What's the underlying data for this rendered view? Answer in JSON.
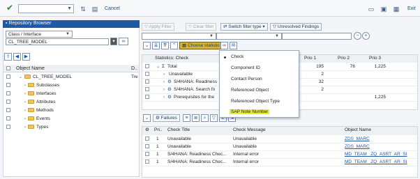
{
  "toolbar": {
    "cancel_label": "Cancel",
    "exit_label": "Exit"
  },
  "left": {
    "header_title": "Repository Browser",
    "object_type_value": "Class / Interface",
    "object_name_value": "CL_TREE_MODEL",
    "col_object_name": "Object Name",
    "col_d": "D..",
    "tree": [
      {
        "label": "CL_TREE_MODEL",
        "extra": "Tre"
      },
      {
        "label": "Subclasses"
      },
      {
        "label": "Interfaces"
      },
      {
        "label": "Attributes"
      },
      {
        "label": "Methods"
      },
      {
        "label": "Events"
      },
      {
        "label": "Types"
      }
    ]
  },
  "filters": {
    "apply": "Apply Filter",
    "clear": "Clear filter",
    "switch": "Switch filter type",
    "unresolved": "Unresolved Findings"
  },
  "stats": {
    "choose_label": "Choose statistic",
    "col_check": "Statistics: Check",
    "col_prio1": "Prio 1",
    "col_prio2": "Prio 2",
    "col_prio3": "Prio 3",
    "rows": [
      {
        "label": "Total",
        "p1": "195",
        "p2": "76",
        "p3": "1,225"
      },
      {
        "label": "Unavailable",
        "p1": "2",
        "p2": "",
        "p3": ""
      },
      {
        "label": "S/4HANA: Readiness",
        "p1": "32",
        "p2": "",
        "p3": ""
      },
      {
        "label": "S/4HANA: Search fo",
        "p1": "2",
        "p2": "",
        "p3": ""
      },
      {
        "label": "Prerequisites for the",
        "p1": "",
        "p2": "",
        "p3": "1,225"
      }
    ]
  },
  "menu": {
    "items": [
      "Check",
      "Component ID",
      "Contact Person",
      "Referenced Object",
      "Referenced Object Type",
      "SAP Note Number"
    ],
    "highlight_color": "#e6ef2f"
  },
  "findings": {
    "failures_label": "Failures",
    "col_pri": "Pri..",
    "col_check_title": "Check Title",
    "col_check_message": "Check Message",
    "col_object_name": "Object Name",
    "rows": [
      {
        "pri": "1",
        "title": "Unavailable",
        "message": "Unavailable",
        "object": "ZDS_MARC"
      },
      {
        "pri": "1",
        "title": "Unavailable",
        "message": "Unavailable",
        "object": "ZDS_MARC"
      },
      {
        "pri": "1",
        "title": "S/4HANA: Readiness Chec...",
        "message": "Internal error",
        "object": "MD_TEAM_   ZQ_ASRT_AR_SI"
      },
      {
        "pri": "1",
        "title": "S/4HANA: Readiness Chec...",
        "message": "Internal error",
        "object": "MD_TEAM_   ZQ_ASRT_AR_SI"
      }
    ]
  }
}
